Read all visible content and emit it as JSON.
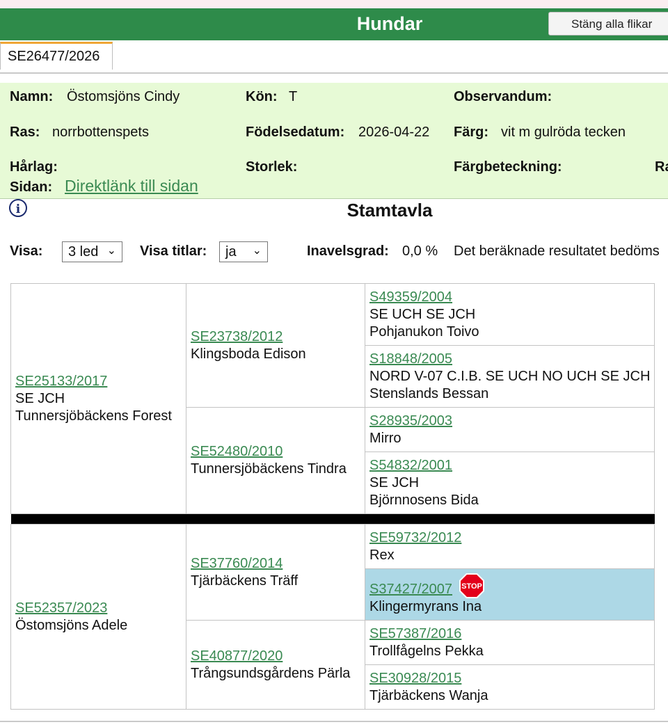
{
  "app": {
    "title": "Hundar",
    "close_all_tabs": "Stäng alla flikar"
  },
  "tabs": [
    {
      "label": "SE26477/2026"
    }
  ],
  "dog": {
    "name_label": "Namn:",
    "name": "Östomsjöns Cindy",
    "sex_label": "Kön:",
    "sex": "T",
    "observandum_label": "Observandum:",
    "breed_label": "Ras:",
    "breed": "norrbottenspets",
    "birth_label": "Födelsedatum:",
    "birth": "2026-04-22",
    "color_label": "Färg:",
    "color": "vit m gulröda tecken",
    "coat_label": "Hårlag:",
    "size_label": "Storlek:",
    "color_code_label": "Färgbeteckning:",
    "cut_label": "Ra",
    "page_label": "Sidan:",
    "page_link": "Direktlänk till sidan"
  },
  "pedigree_title": "Stamtavla",
  "options": {
    "show_label": "Visa:",
    "show_value": "3 led",
    "titles_label": "Visa titlar:",
    "titles_value": "ja",
    "inbreeding_label": "Inavelsgrad:",
    "inbreeding_value": "0,0 %",
    "note": "Det beräknade resultatet bedöms"
  },
  "pedigree": {
    "sire": {
      "reg": "SE25133/2017",
      "title": "SE JCH",
      "name": "Tunnersjöbäckens Forest",
      "sire": {
        "reg": "SE23738/2012",
        "name": "Klingsboda Edison",
        "sire": {
          "reg": "S49359/2004",
          "title": "SE UCH SE JCH",
          "name": "Pohjanukon Toivo"
        },
        "dam": {
          "reg": "S18848/2005",
          "title": "NORD V-07 C.I.B. SE UCH NO UCH SE JCH",
          "name": "Stenslands Bessan"
        }
      },
      "dam": {
        "reg": "SE52480/2010",
        "name": "Tunnersjöbäckens Tindra",
        "sire": {
          "reg": "S28935/2003",
          "name": "Mirro"
        },
        "dam": {
          "reg": "S54832/2001",
          "title": "SE JCH",
          "name": "Björnnosens Bida"
        }
      }
    },
    "dam": {
      "reg": "SE52357/2023",
      "name": "Östomsjöns Adele",
      "sire": {
        "reg": "SE37760/2014",
        "name": "Tjärbäckens Träff",
        "sire": {
          "reg": "SE59732/2012",
          "name": "Rex"
        },
        "dam": {
          "reg": "S37427/2007",
          "name": "Klingermyrans Ina",
          "stop_badge": "STOP"
        }
      },
      "dam": {
        "reg": "SE40877/2020",
        "name": "Trångsundsgårdens Pärla",
        "sire": {
          "reg": "SE57387/2016",
          "name": "Trollfågelns Pekka"
        },
        "dam": {
          "reg": "SE30928/2015",
          "name": "Tjärbäckens Wanja"
        }
      }
    }
  },
  "colors": {
    "header_green": "#2e8b4a",
    "info_bg": "#e7fad6",
    "link": "#3a8a52",
    "highlight": "#add8e6",
    "stop_red": "#e3001b",
    "tab_accent": "#f0a636"
  },
  "icons": {
    "info": "info-icon",
    "stop": "stop-sign-icon",
    "dropdown": "chevron-down-icon"
  }
}
